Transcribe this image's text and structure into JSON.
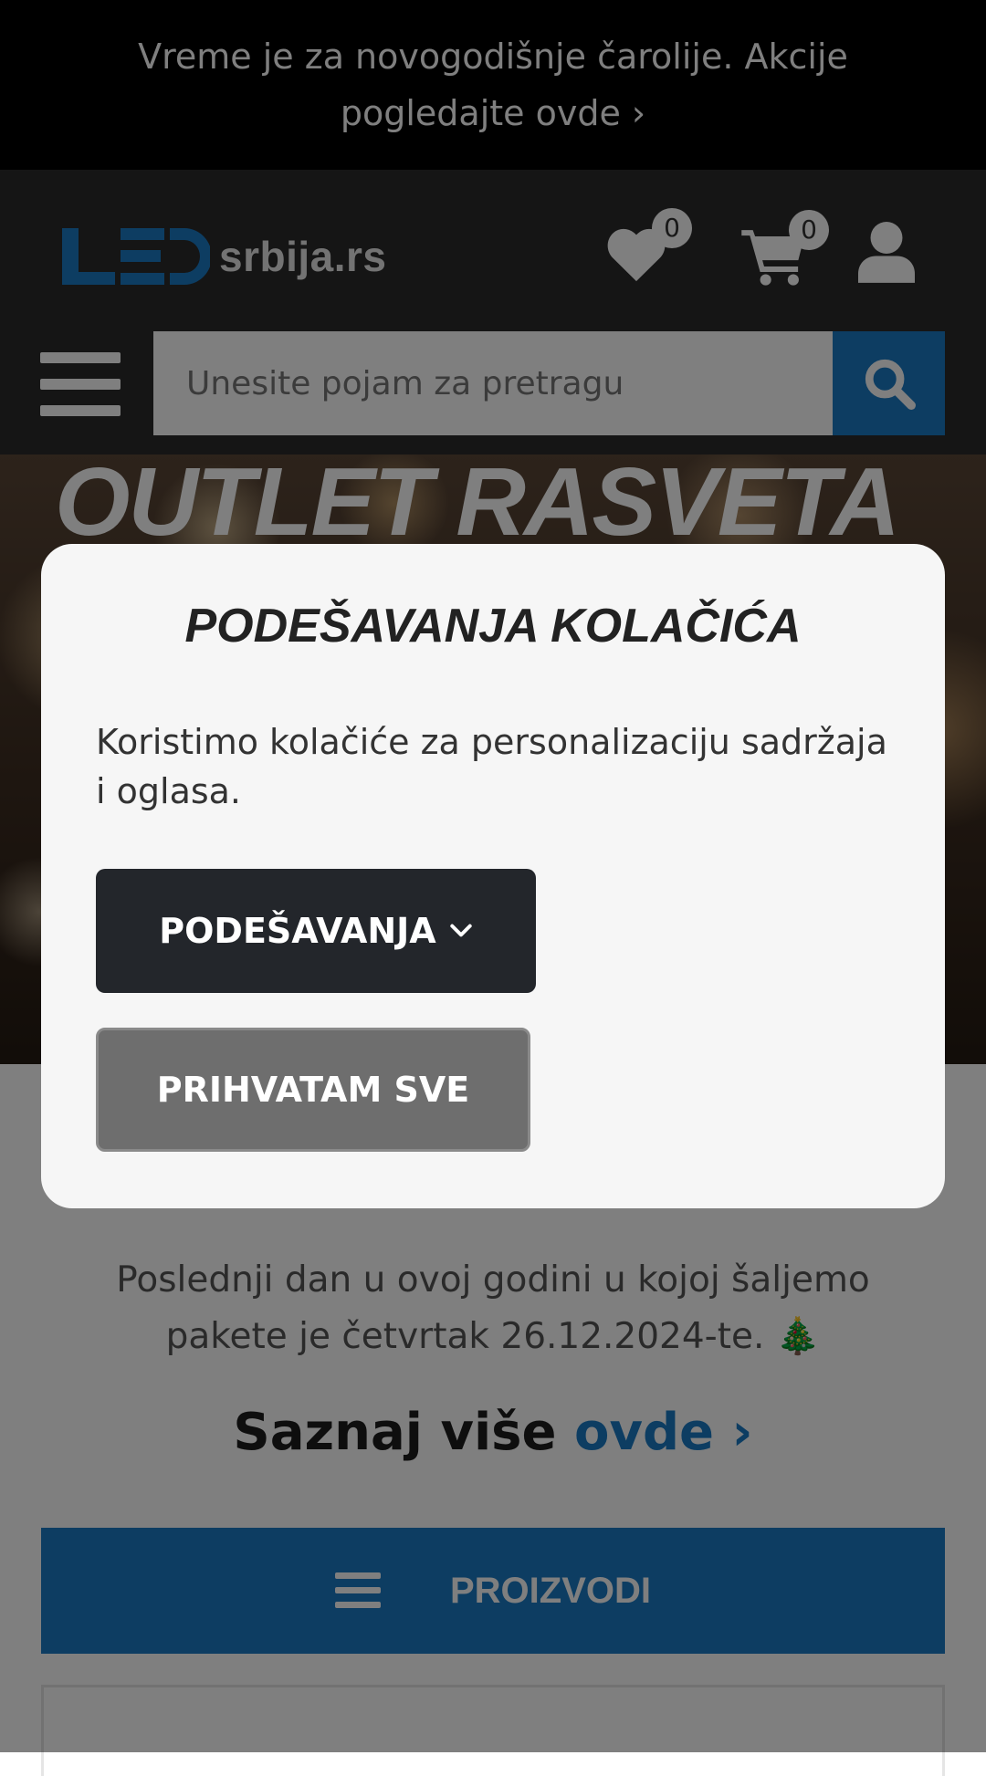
{
  "promo_bar": {
    "text": "Vreme je za novogodišnje čarolije. Akcije pogledajte ovde ›"
  },
  "header": {
    "logo_text": "srbija.rs",
    "wishlist_count": "0",
    "cart_count": "0"
  },
  "search": {
    "placeholder": "Unesite pojam za pretragu"
  },
  "hero": {
    "title": "OUTLET RASVETA"
  },
  "notice": {
    "text": "Poslednji dan u ovoj godini u kojoj šaljemo pakete je četvrtak 26.12.2024-te. 🎄",
    "more_prefix": "Saznaj više",
    "more_link": "ovde ›"
  },
  "products_button": {
    "label": "PROIZVODI"
  },
  "cookie_modal": {
    "title": "PODEŠAVANJA KOLAČIĆA",
    "text": "Koristimo kolačiće za personalizaciju sadržaja i oglasa.",
    "settings_label": "PODEŠAVANJA",
    "accept_label": "PRIHVATAM SVE"
  },
  "colors": {
    "accent_blue": "#1a7ac4",
    "header_bg": "#2a2a2a",
    "promo_bg": "#000000",
    "settings_button_bg": "#23262b",
    "accept_button_bg": "#6e6e6e"
  },
  "icons": {
    "wishlist": "heart-icon",
    "cart": "cart-icon",
    "account": "user-icon",
    "search": "search-icon",
    "menu": "hamburger-menu-icon",
    "settings_toggle": "chevron-down-icon"
  }
}
